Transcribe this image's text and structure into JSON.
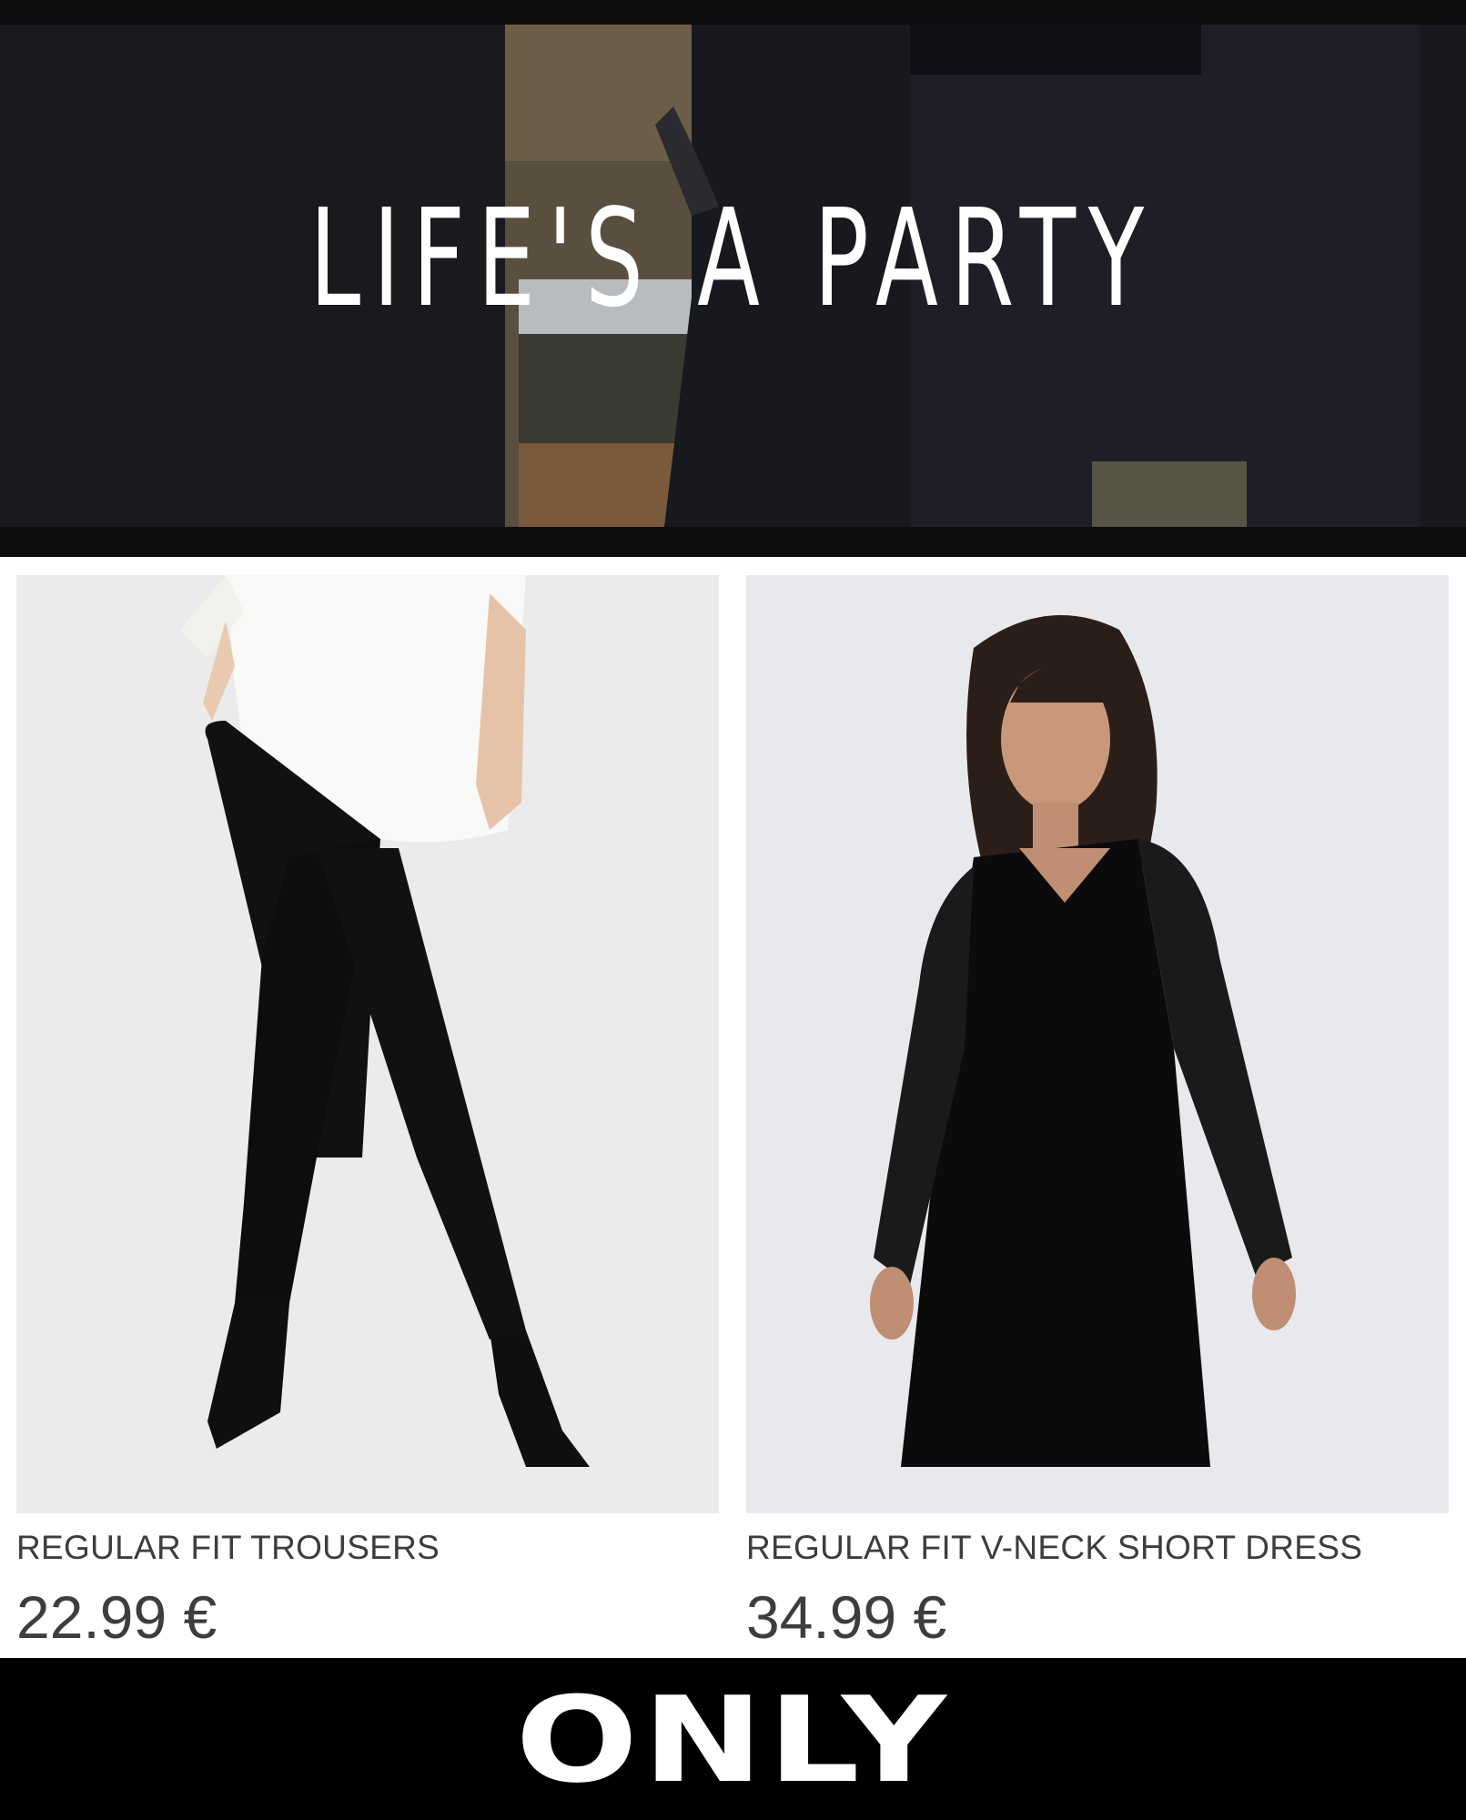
{
  "hero": {
    "title": "LIFE'S A PARTY"
  },
  "products": [
    {
      "name": "REGULAR FIT TROUSERS",
      "price": "22.99 €"
    },
    {
      "name": "REGULAR FIT V-NECK SHORT DRESS",
      "price": "34.99 €"
    }
  ],
  "footer": {
    "logo": "ONLY"
  },
  "colors": {
    "background": "#ffffff",
    "footer": "#000000",
    "text": "#3d3d3d",
    "hero_text": "#ffffff"
  }
}
